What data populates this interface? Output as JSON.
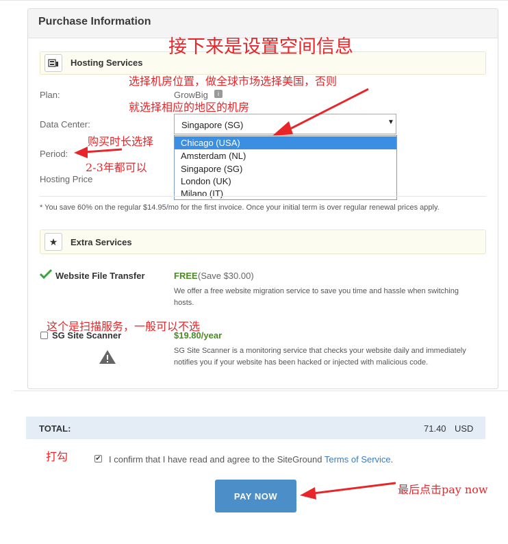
{
  "panel": {
    "title": "Purchase Information"
  },
  "hosting": {
    "section_label": "Hosting Services",
    "plan_label": "Plan:",
    "plan_value": "GrowBig",
    "datacenter_label": "Data Center:",
    "datacenter_selected": "Singapore (SG)",
    "datacenter_options": [
      "Chicago (USA)",
      "Amsterdam (NL)",
      "Singapore (SG)",
      "London (UK)",
      "Milano (IT)"
    ],
    "highlighted_option": "Chicago (USA)",
    "period_label": "Period:",
    "price_label": "Hosting Price",
    "savings_note": "* You save 60% on the regular $14.95/mo for the first invoice. Once your initial term is over regular renewal prices apply."
  },
  "extra": {
    "section_label": "Extra Services",
    "transfer": {
      "name": "Website File Transfer",
      "price": "FREE",
      "save": "(Save $30.00)",
      "desc_line1": "We offer a free website migration service to save you time and hassle when switching",
      "desc_line2": "hosts.",
      "checked": true
    },
    "scanner": {
      "name": "SG Site Scanner",
      "price": "$19.80/year",
      "desc_line1": "SG Site Scanner is a monitoring service that checks your website daily and immediately",
      "desc_line2": "notifies you if your website has been hacked or injected with malicious code.",
      "checked": false
    }
  },
  "total": {
    "label": "TOTAL:",
    "amount": "71.40",
    "currency": "USD"
  },
  "confirm": {
    "text": "I confirm that I have read and agree to the SiteGround",
    "link": "Terms of Service",
    "end": ".",
    "checked": true
  },
  "pay_button": "PAY NOW",
  "annotations": {
    "title": "接下来是设置空间信息",
    "dc_line1": "选择机房位置，做全球市场选择美国，否则",
    "dc_line2": "就选择相应的地区的机房",
    "period_line1": "购买时长选择",
    "period_line2": "2-3年都可以",
    "scanner": "这个是扫描服务，一般可以不选",
    "checkbox": "打勾",
    "pay": "最后点击pay now"
  },
  "colors": {
    "accent_blue": "#4b8ec8",
    "annotation_red": "#e8262a",
    "free_green": "#4a8a26",
    "check_green": "#3aa33a"
  },
  "icons": {
    "hosting": "server-icon",
    "extra": "star-icon",
    "transfer": "checkmark-icon",
    "scanner": "warning-icon",
    "plan": "info-icon"
  }
}
